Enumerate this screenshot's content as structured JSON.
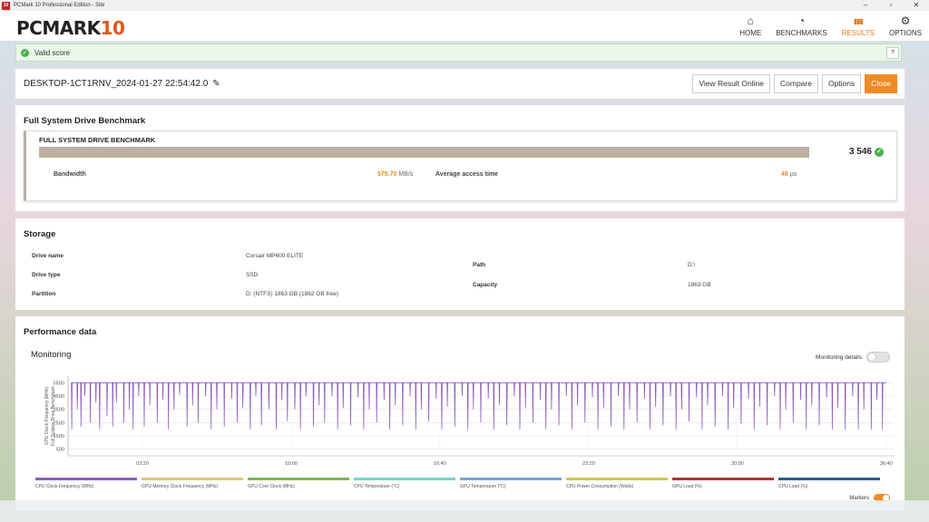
{
  "window": {
    "title": "PCMark 10 Professional Edition - Site",
    "app_icon": "10"
  },
  "header": {
    "logo_main": "PCMARK",
    "logo_num": "10",
    "nav": [
      {
        "label": "HOME",
        "icon": "⌂"
      },
      {
        "label": "BENCHMARKS",
        "icon": "◔"
      },
      {
        "label": "RESULTS",
        "icon": "▮▮▮"
      },
      {
        "label": "OPTIONS",
        "icon": "⚙"
      }
    ]
  },
  "status": {
    "text": "Valid score",
    "help": "?"
  },
  "result": {
    "name": "DESKTOP-1CT1RNV_2024-01-27 22:54:42.0",
    "buttons": {
      "view_online": "View Result Online",
      "compare": "Compare",
      "options": "Options",
      "close": "Close"
    }
  },
  "benchmark": {
    "section_title": "Full System Drive Benchmark",
    "box_label": "FULL SYSTEM DRIVE BENCHMARK",
    "score": "3 546",
    "bandwidth_label": "Bandwidth",
    "bandwidth_value": "575.70",
    "bandwidth_unit": "MB/s",
    "access_label": "Average access time",
    "access_value": "48",
    "access_unit": "µs"
  },
  "storage": {
    "title": "Storage",
    "drive_name_label": "Drive name",
    "drive_name": "Corsair MP600 ELITE",
    "drive_type_label": "Drive type",
    "drive_type": "SSD",
    "partition_label": "Partition",
    "partition": "D: (NTFS) 1863 GB (1862 GB free)",
    "path_label": "Path",
    "path": "D:\\",
    "capacity_label": "Capacity",
    "capacity": "1863 GB"
  },
  "performance": {
    "title": "Performance data",
    "monitoring": "Monitoring",
    "monitoring_details": "Monitoring details",
    "markers": "Markers",
    "legend": [
      {
        "label": "CPU Clock Frequency (MHz)",
        "color": "#8e5bbd"
      },
      {
        "label": "GPU Memory Clock Frequency (MHz)",
        "color": "#e3c67a"
      },
      {
        "label": "GPU Core Clock (MHz)",
        "color": "#7ab84a"
      },
      {
        "label": "CPU Temperature (°C)",
        "color": "#74d6c8"
      },
      {
        "label": "GPU Temperature (°C)",
        "color": "#72a8d8"
      },
      {
        "label": "CPU Power Consumption (Watts)",
        "color": "#d0c84a"
      },
      {
        "label": "GPU Load (%)",
        "color": "#b83232"
      },
      {
        "label": "CPU Load (%)",
        "color": "#2a5d9a"
      }
    ]
  },
  "chart_data": {
    "type": "line",
    "title": "",
    "xlabel": "",
    "ylabel": "CPU Clock Frequency (MHz)",
    "ylabel2": "Full System Drive Benchmark",
    "y_ticks": [
      500,
      1500,
      2500,
      3500,
      4500,
      5500
    ],
    "ylim": [
      0,
      6000
    ],
    "x_ticks": [
      "03:20",
      "10:00",
      "16:40",
      "23:20",
      "30:00",
      "36:40"
    ],
    "x_tick_seconds": [
      200,
      600,
      1000,
      1400,
      1800,
      2200
    ],
    "xlim": [
      0,
      2220
    ],
    "series": [
      {
        "name": "CPU Clock Frequency (MHz)",
        "baseline": 5500,
        "dips": [
          [
            10,
            2000
          ],
          [
            25,
            3500
          ],
          [
            35,
            2200
          ],
          [
            45,
            4500
          ],
          [
            60,
            2500
          ],
          [
            75,
            4000
          ],
          [
            85,
            2000
          ],
          [
            105,
            3000
          ],
          [
            120,
            2200
          ],
          [
            130,
            4000
          ],
          [
            150,
            2500
          ],
          [
            165,
            3500
          ],
          [
            175,
            2000
          ],
          [
            190,
            4500
          ],
          [
            205,
            2200
          ],
          [
            220,
            3800
          ],
          [
            240,
            2500
          ],
          [
            255,
            4200
          ],
          [
            270,
            2000
          ],
          [
            285,
            3500
          ],
          [
            300,
            4600
          ],
          [
            320,
            2200
          ],
          [
            335,
            3800
          ],
          [
            350,
            2500
          ],
          [
            370,
            4500
          ],
          [
            385,
            2000
          ],
          [
            400,
            3500
          ],
          [
            420,
            2200
          ],
          [
            440,
            4300
          ],
          [
            455,
            2500
          ],
          [
            470,
            3600
          ],
          [
            490,
            2000
          ],
          [
            505,
            4500
          ],
          [
            520,
            2300
          ],
          [
            540,
            3500
          ],
          [
            560,
            2000
          ],
          [
            575,
            4200
          ],
          [
            590,
            2600
          ],
          [
            610,
            3500
          ],
          [
            625,
            2000
          ],
          [
            640,
            4500
          ],
          [
            660,
            2200
          ],
          [
            675,
            3800
          ],
          [
            690,
            2500
          ],
          [
            710,
            4500
          ],
          [
            725,
            2000
          ],
          [
            740,
            3600
          ],
          [
            760,
            2300
          ],
          [
            780,
            4400
          ],
          [
            795,
            2000
          ],
          [
            810,
            3500
          ],
          [
            830,
            2500
          ],
          [
            850,
            4200
          ],
          [
            865,
            2000
          ],
          [
            880,
            3800
          ],
          [
            900,
            2300
          ],
          [
            920,
            4500
          ],
          [
            935,
            2000
          ],
          [
            950,
            3500
          ],
          [
            970,
            2600
          ],
          [
            990,
            4300
          ],
          [
            1005,
            2000
          ],
          [
            1020,
            3700
          ],
          [
            1040,
            2200
          ],
          [
            1060,
            4500
          ],
          [
            1075,
            2000
          ],
          [
            1090,
            3500
          ],
          [
            1110,
            2500
          ],
          [
            1130,
            4300
          ],
          [
            1145,
            2000
          ],
          [
            1160,
            3800
          ],
          [
            1180,
            2300
          ],
          [
            1200,
            4500
          ],
          [
            1215,
            2000
          ],
          [
            1230,
            3600
          ],
          [
            1250,
            2500
          ],
          [
            1270,
            4200
          ],
          [
            1285,
            2000
          ],
          [
            1300,
            3500
          ],
          [
            1320,
            2300
          ],
          [
            1340,
            4500
          ],
          [
            1355,
            2000
          ],
          [
            1370,
            3800
          ],
          [
            1390,
            2500
          ],
          [
            1410,
            4400
          ],
          [
            1425,
            2000
          ],
          [
            1440,
            3600
          ],
          [
            1460,
            2200
          ],
          [
            1480,
            4500
          ],
          [
            1495,
            2000
          ],
          [
            1510,
            3500
          ],
          [
            1530,
            2500
          ],
          [
            1550,
            4300
          ],
          [
            1565,
            2000
          ],
          [
            1580,
            3700
          ],
          [
            1600,
            2300
          ],
          [
            1620,
            4500
          ],
          [
            1635,
            2000
          ],
          [
            1650,
            3500
          ],
          [
            1670,
            2600
          ],
          [
            1690,
            4400
          ],
          [
            1705,
            2000
          ],
          [
            1720,
            3800
          ],
          [
            1740,
            2200
          ],
          [
            1760,
            4500
          ],
          [
            1775,
            2000
          ],
          [
            1790,
            3600
          ],
          [
            1810,
            2400
          ],
          [
            1830,
            4300
          ],
          [
            1845,
            2000
          ],
          [
            1860,
            3700
          ],
          [
            1880,
            2300
          ],
          [
            1900,
            4500
          ],
          [
            1915,
            2000
          ],
          [
            1930,
            3500
          ],
          [
            1950,
            2500
          ],
          [
            1970,
            4200
          ],
          [
            1985,
            2000
          ],
          [
            2000,
            3800
          ],
          [
            2020,
            2300
          ],
          [
            2040,
            4400
          ],
          [
            2055,
            2000
          ],
          [
            2070,
            3600
          ],
          [
            2090,
            2000
          ],
          [
            2110,
            4500
          ],
          [
            2125,
            2000
          ],
          [
            2140,
            3500
          ],
          [
            2160,
            2000
          ],
          [
            2175,
            4200
          ],
          [
            2190,
            2000
          ]
        ]
      }
    ],
    "grid": true
  }
}
